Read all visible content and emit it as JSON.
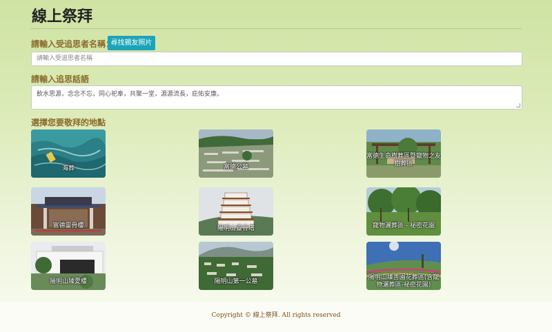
{
  "page": {
    "title": "線上祭拜"
  },
  "name_section": {
    "label": "請輸入受追思者名稱：",
    "find_button": "尋找親友照片",
    "placeholder": "請輸入受追思者名稱"
  },
  "message_section": {
    "label": "請輸入追思話語",
    "text": "飲水思源，念念不忘，同心祀奉，共聚一堂，源源流長，庇佑安康。"
  },
  "locations_section": {
    "label": "選擇您要敬拜的地點",
    "locations": [
      {
        "caption": "海葬"
      },
      {
        "caption": "富德公墓"
      },
      {
        "caption": "富德生命樹葬區暨寵物之友樹葬區"
      },
      {
        "caption": "富德靈骨樓"
      },
      {
        "caption": "陽明山靈骨塔"
      },
      {
        "caption": "寵物灑葬區 - 祕密花園"
      },
      {
        "caption": "陽明山臻愛樓"
      },
      {
        "caption": "陽明山第一公墓"
      },
      {
        "caption": "陽明山臻善園花葬區(含寵物灑葬區-祕密花園)"
      }
    ]
  },
  "footer": {
    "copyright": "Copyright © 線上祭拜. All rights reserved"
  }
}
